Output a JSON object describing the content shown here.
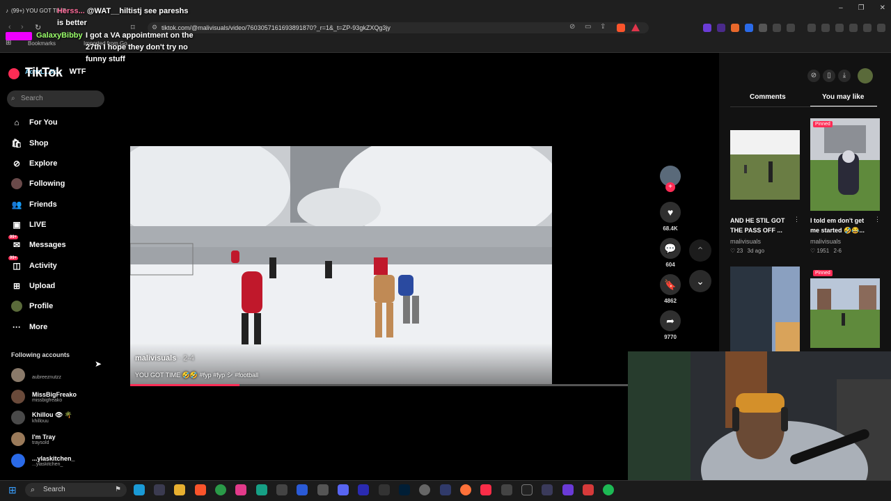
{
  "browser": {
    "tab_title": "(99+) YOU GOT TIME",
    "address": "tiktok.com/@malivisuals/video/7603057161693891870?_r=1&_t=ZP-93gkZXQg3jy",
    "bookmarks_label": "Bookmarks",
    "imported_label": "Imported from Go...",
    "window_controls": [
      "–",
      "❐",
      "✕"
    ]
  },
  "chat_overlay": {
    "lines": [
      {
        "name": "Herss...",
        "text": "@WAT__hiltistj see pareshs is better"
      },
      {
        "name": "GalaxyBibby",
        "text": "I got a VA appointment on the 27th I hope they don't try no funny stuff"
      },
      {
        "name": "AcheL...5k...",
        "text": "WTF"
      }
    ],
    "colors": {
      "galaxybibby": "#9bff6a"
    }
  },
  "sidebar": {
    "logo": "TikTok",
    "search_placeholder": "Search",
    "nav": [
      {
        "label": "For You",
        "icon": "home-icon"
      },
      {
        "label": "Shop",
        "icon": "shopping-bag-icon"
      },
      {
        "label": "Explore",
        "icon": "compass-icon"
      },
      {
        "label": "Following",
        "icon": "following-avatar-icon"
      },
      {
        "label": "Friends",
        "icon": "friends-icon"
      },
      {
        "label": "LIVE",
        "icon": "live-tv-icon"
      },
      {
        "label": "Messages",
        "icon": "messages-icon",
        "badge": "99+"
      },
      {
        "label": "Activity",
        "icon": "activity-icon",
        "badge": "99+"
      },
      {
        "label": "Upload",
        "icon": "upload-plus-icon"
      },
      {
        "label": "Profile",
        "icon": "profile-avatar-icon"
      },
      {
        "label": "More",
        "icon": "more-dots-icon"
      }
    ],
    "following_heading": "Following accounts",
    "accounts": [
      {
        "name": "",
        "handle": "aubreeznutzz"
      },
      {
        "name": "MissBigFreako",
        "handle": "missbigfreako"
      },
      {
        "name": "Khillou 👁 🌴",
        "handle": "khillouu"
      },
      {
        "name": "I'm Tray",
        "handle": "traysold"
      },
      {
        "name": "...ylaskitchen_",
        "handle": "...ylaskitchen_"
      }
    ]
  },
  "video": {
    "author": "malivisuals",
    "date": "· 2-4",
    "caption": "YOU GOT TIME 🤣🤣 #fyp #fyp シ #football",
    "progress": 0.22
  },
  "actions": {
    "likes": "68.4K",
    "comments": "604",
    "saves": "4862",
    "shares": "9770"
  },
  "right_panel": {
    "tabs": [
      "Comments",
      "You may like"
    ],
    "active_tab": "You may like",
    "items": [
      {
        "title": "AND HE STIL GOT THE PASS OFF ...",
        "author": "malivisuals",
        "likes": "23",
        "age": "3d ago",
        "pinned": false
      },
      {
        "title": "I told em don't get me started 🤣😂...",
        "author": "malivisuals",
        "likes": "1951",
        "age": "2-6",
        "pinned": true
      },
      {
        "title": "",
        "author": "",
        "likes": "",
        "age": "",
        "pinned": false
      },
      {
        "title": "",
        "author": "",
        "likes": "",
        "age": "",
        "pinned": true
      }
    ],
    "pinned_label": "Pinned"
  },
  "taskbar": {
    "search_label": "Search"
  },
  "accent": "#fe2c55"
}
